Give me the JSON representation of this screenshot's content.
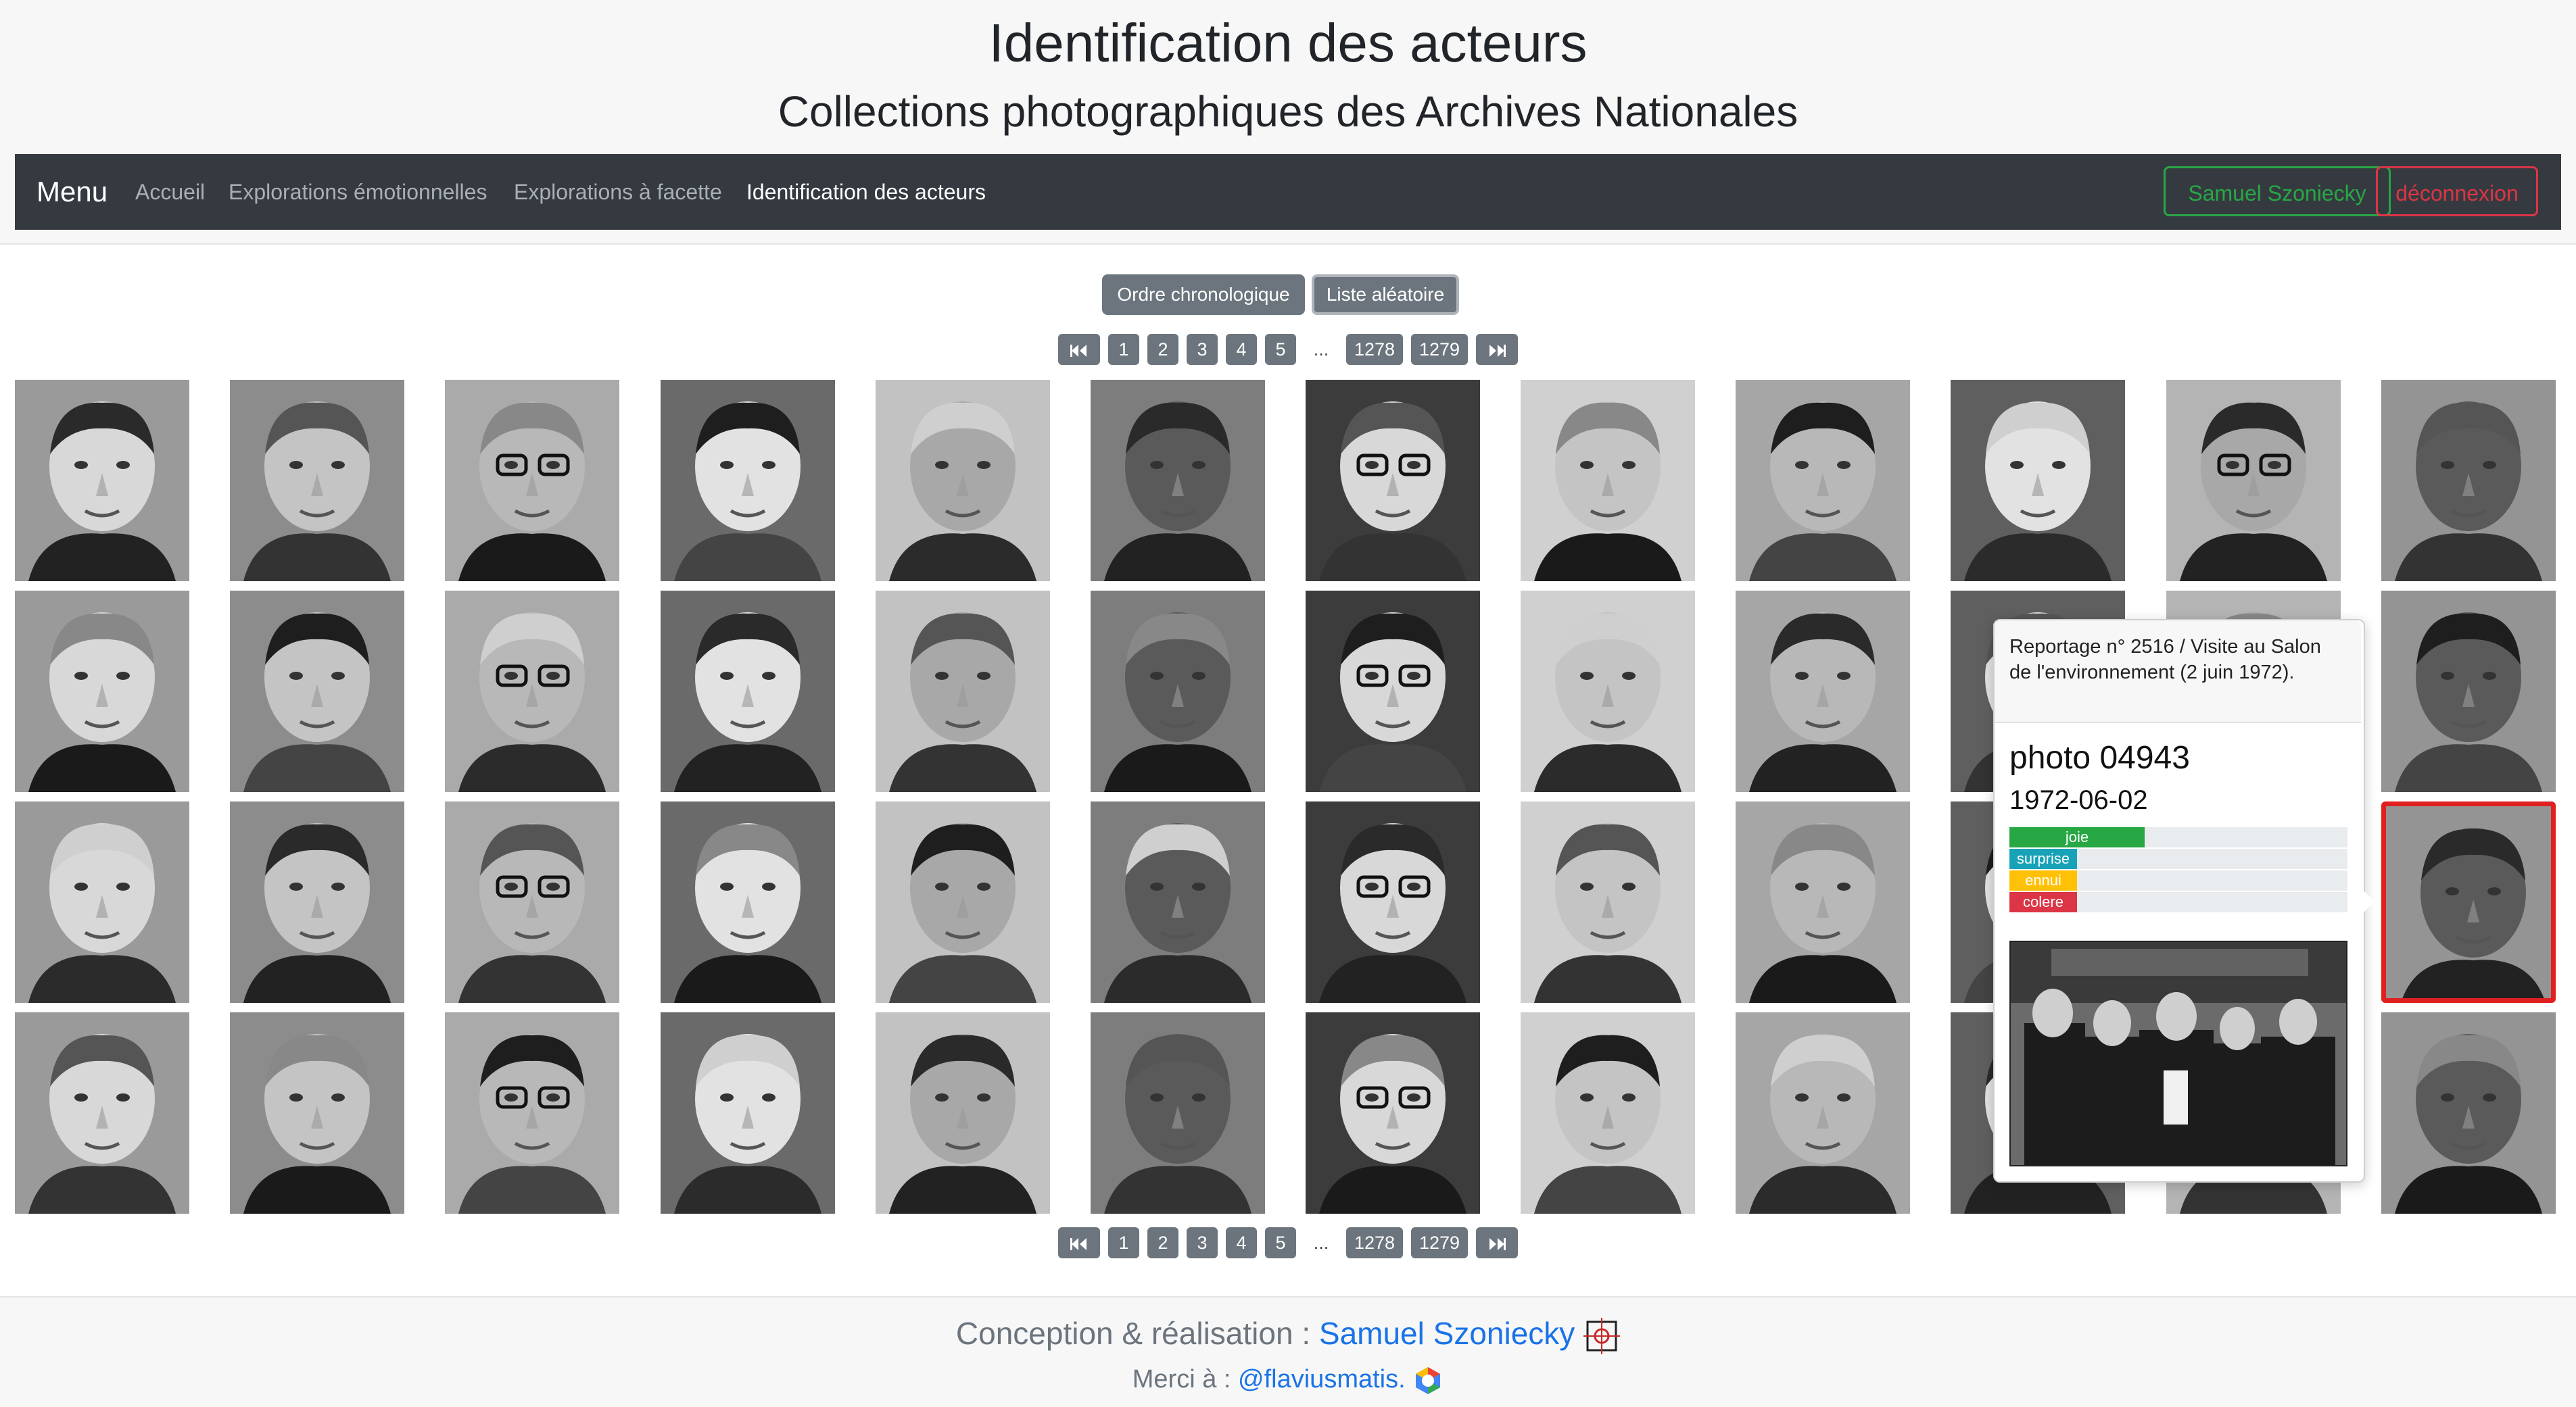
{
  "header": {
    "title": "Identification des acteurs",
    "subtitle": "Collections photographiques des Archives Nationales"
  },
  "navbar": {
    "brand": "Menu",
    "links": [
      "Accueil",
      "Explorations émotionnelles",
      "Explorations à facette",
      "Identification des acteurs"
    ],
    "active_link": "Identification des acteurs",
    "user_button": "Samuel Szoniecky",
    "logout_button": "déconnexion"
  },
  "sort": {
    "chronological": "Ordre chronologique",
    "random": "Liste aléatoire",
    "active": "Liste aléatoire"
  },
  "pagination": {
    "first_icon": "double-chevron-left-icon",
    "last_icon": "double-chevron-right-icon",
    "pages": [
      "1",
      "2",
      "3",
      "4",
      "5"
    ],
    "ellipsis": "...",
    "last_pages": [
      "1278",
      "1279"
    ]
  },
  "grid": {
    "rows": 4,
    "columns": 12,
    "selected": {
      "row": 3,
      "column": 12
    }
  },
  "popover": {
    "header": "Reportage n° 2516 / Visite au Salon de l'environnement (2 juin 1972).",
    "photo_title": "photo 04943",
    "date": "1972-06-02",
    "emotions": [
      {
        "label": "joie",
        "value": 0.4,
        "color": "#28a745"
      },
      {
        "label": "surprise",
        "value": 0.2,
        "color": "#17a2b8"
      },
      {
        "label": "ennui",
        "value": 0.2,
        "color": "#ffc107"
      },
      {
        "label": "colere",
        "value": 0.2,
        "color": "#dc3545"
      }
    ]
  },
  "footer": {
    "credit_prefix": "Conception & réalisation :",
    "credit_author": "Samuel Szoniecky",
    "lab_logo": "LABORATOIRE PARAGRAPHE",
    "thanks_prefix": "Merci à :",
    "thanks_handle": "@flaviusmatis.",
    "platform_logo": "Google Cloud Platform"
  }
}
